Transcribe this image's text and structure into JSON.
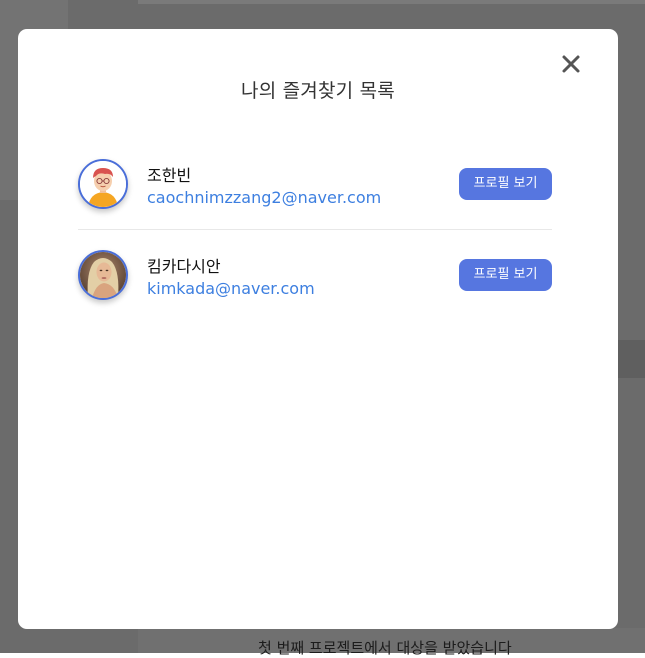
{
  "modal": {
    "title": "나의 즐겨찾기 목록",
    "close_icon": "close-icon"
  },
  "favorites": [
    {
      "name": "조한빈",
      "email": "caochnimzzang2@naver.com",
      "avatar": "cartoon-boy-avatar",
      "button_label": "프로필 보기"
    },
    {
      "name": "킴카다시안",
      "email": "kimkada@naver.com",
      "avatar": "photo-woman-avatar",
      "button_label": "프로필 보기"
    }
  ],
  "background": {
    "footer_text": "첫 번째 프로젝트에서 대상을 받았습니다"
  },
  "colors": {
    "accent": "#5676e0",
    "email": "#3d7fe0",
    "avatar_border": "#4a6ed9",
    "overlay": "#6b6b6b"
  }
}
